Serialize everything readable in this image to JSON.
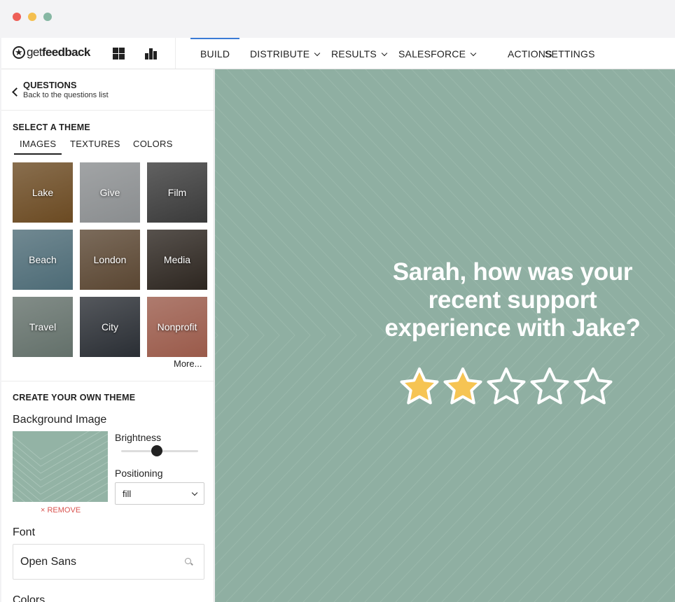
{
  "nav": {
    "logo_prefix": "get",
    "logo_suffix": "feedback",
    "items": [
      {
        "label": "BUILD",
        "dropdown": false,
        "active": true
      },
      {
        "label": "DISTRIBUTE",
        "dropdown": true
      },
      {
        "label": "RESULTS",
        "dropdown": true
      },
      {
        "label": "SALESFORCE",
        "dropdown": true
      },
      {
        "label": "ACTIONS",
        "dropdown": false
      },
      {
        "label": "SETTINGS",
        "dropdown": false
      }
    ],
    "accent_color": "#3a7bd5"
  },
  "sidebar": {
    "back_title": "QUESTIONS",
    "back_subtitle": "Back to the questions list",
    "select_theme_title": "SELECT A THEME",
    "tabs": [
      "IMAGES",
      "TEXTURES",
      "COLORS"
    ],
    "active_tab": "IMAGES",
    "themes": [
      {
        "label": "Lake",
        "color": "#6b4a22"
      },
      {
        "label": "Give",
        "color": "#8a8d8f"
      },
      {
        "label": "Film",
        "color": "#3a3a3a"
      },
      {
        "label": "Beach",
        "color": "#4d6b76"
      },
      {
        "label": "London",
        "color": "#5a4632"
      },
      {
        "label": "Media",
        "color": "#2d2620"
      },
      {
        "label": "Travel",
        "color": "#63706a"
      },
      {
        "label": "City",
        "color": "#2a2e34"
      },
      {
        "label": "Nonprofit",
        "color": "#9a5a4a"
      }
    ],
    "more_label": "More...",
    "create_theme_title": "CREATE YOUR OWN THEME",
    "background_image_label": "Background Image",
    "brightness_label": "Brightness",
    "brightness_value": 0.5,
    "positioning_label": "Positioning",
    "positioning_value": "fill",
    "remove_label": "× REMOVE",
    "font_label": "Font",
    "font_value": "Open Sans",
    "colors_label": "Colors"
  },
  "preview": {
    "question": "Sarah, how was your recent support experience with Jake?",
    "rating": 2,
    "max_rating": 5,
    "background_color": "#8fafa2",
    "star_fill_color": "#f6c453"
  }
}
